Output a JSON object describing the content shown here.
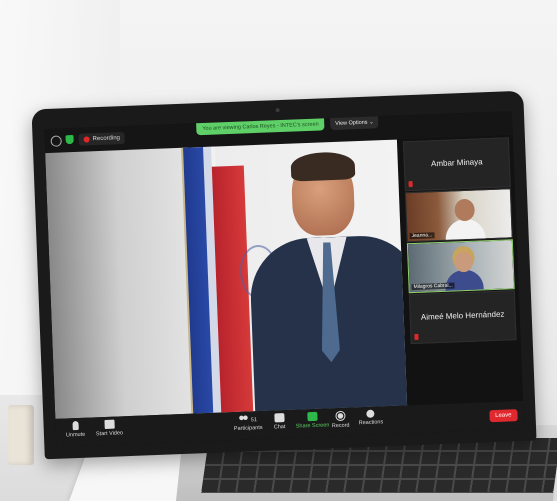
{
  "window": {
    "recording_label": "Recording",
    "share_banner_text": "You are viewing Carlos Reyes - INTEC's screen",
    "view_options_label": "View Options",
    "view_options_chevron": "chevron-down-icon"
  },
  "gallery": {
    "tiles": [
      {
        "name": "Ambar Minaya",
        "video": false
      },
      {
        "name": "Jeanna...",
        "video": true
      },
      {
        "name": "Milagros Cabral...",
        "video": true
      },
      {
        "name": "Aimeé Melo Hernández",
        "video": false
      }
    ]
  },
  "toolbar": {
    "unmute_label": "Unmute",
    "start_video_label": "Start Video",
    "participants_label": "Participants",
    "participants_count": "51",
    "chat_label": "Chat",
    "share_screen_label": "Share Screen",
    "record_label": "Record",
    "reactions_label": "Reactions",
    "leave_label": "Leave"
  },
  "colors": {
    "share_green": "#5fd068",
    "leave_red": "#e0282f",
    "recording_red": "#e02828"
  }
}
